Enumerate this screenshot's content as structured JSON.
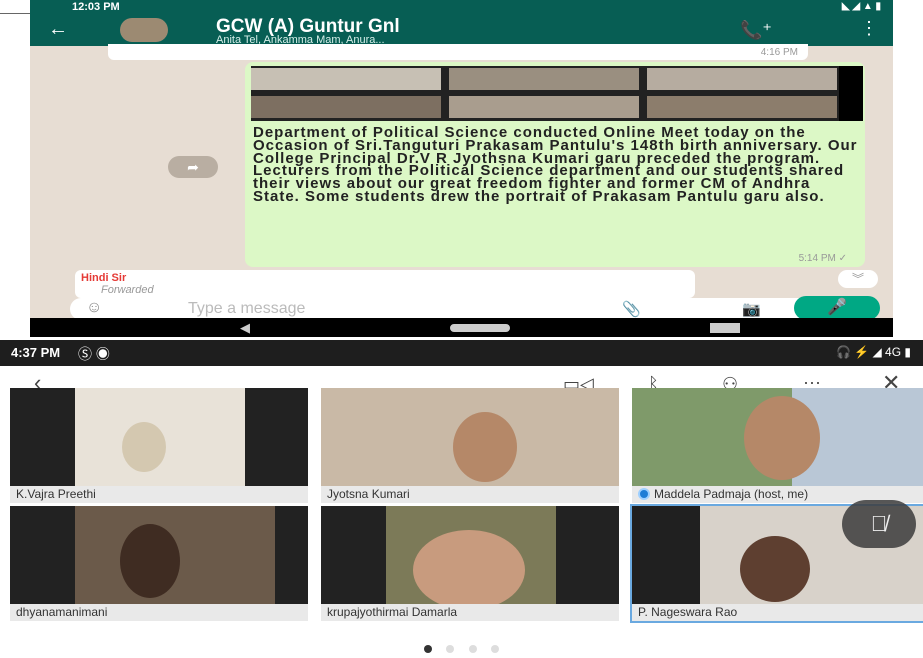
{
  "whatsapp": {
    "status_time": "12:03 PM",
    "status_icons": "◣ ◢ ▲ ▮",
    "back_icon": "arrow-left-icon",
    "group_name": "GCW (A) Guntur Gnl",
    "members": "Anita Tel, Ankamma Mam, Anura...",
    "prev_message_time": "4:16 PM",
    "message_text": "Department of Political Science conducted Online Meet today on the Occasion of Sri.Tanguturi Prakasam Pantulu's 148th birth anniversary. Our College Principal Dr.V R Jyothsna Kumari garu preceded the program. Lecturers from the Political Science department and our students shared their views about our great freedom fighter and former CM of Andhra State. Some students drew the portrait of Prakasam Pantulu garu also.",
    "message_time": "5:14 PM ✓",
    "forward_author": "Hindi Sir",
    "forward_label": "Forwarded",
    "composer_placeholder": "Type a message",
    "colors": {
      "header": "#075e54",
      "bubble": "#dcf8c6",
      "accent": "#00a884"
    }
  },
  "zoom": {
    "status_time": "4:37 PM",
    "status_right": "🎧 ⚡ ◢ 4G ▮",
    "participants": [
      {
        "name": "K.Vajra Preethi"
      },
      {
        "name": "Jyotsna Kumari"
      },
      {
        "name": "Maddela Padmaja (host, me)"
      },
      {
        "name": "dhyanamanimani"
      },
      {
        "name": "krupajyothirmai Damarla"
      },
      {
        "name": "P. Nageswara Rao"
      }
    ],
    "pager": {
      "pages": 4,
      "current": 1
    }
  }
}
